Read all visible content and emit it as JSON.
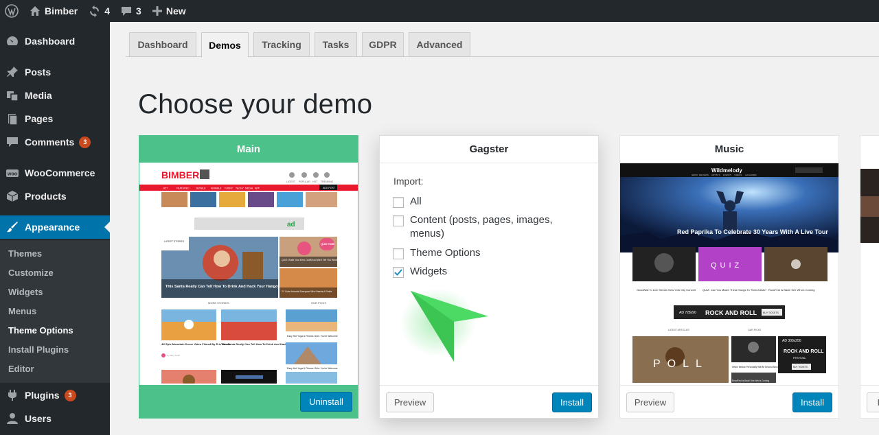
{
  "adminbar": {
    "site_name": "Bimber",
    "updates_count": "4",
    "comments_count": "3",
    "new_label": "New"
  },
  "sidebar": {
    "items": [
      {
        "label": "Dashboard",
        "icon": "dashboard-icon"
      },
      {
        "label": "Posts",
        "icon": "pin-icon"
      },
      {
        "label": "Media",
        "icon": "media-icon"
      },
      {
        "label": "Pages",
        "icon": "pages-icon"
      },
      {
        "label": "Comments",
        "icon": "comment-icon",
        "badge": "3"
      },
      {
        "label": "WooCommerce",
        "icon": "woo-icon"
      },
      {
        "label": "Products",
        "icon": "box-icon"
      },
      {
        "label": "Appearance",
        "icon": "brush-icon",
        "active": true
      },
      {
        "label": "Plugins",
        "icon": "plug-icon",
        "badge": "3"
      },
      {
        "label": "Users",
        "icon": "user-icon"
      }
    ],
    "submenu": [
      "Themes",
      "Customize",
      "Widgets",
      "Menus",
      "Theme Options",
      "Install Plugins",
      "Editor"
    ],
    "submenu_current": "Theme Options"
  },
  "tabs": [
    "Dashboard",
    "Demos",
    "Tracking",
    "Tasks",
    "GDPR",
    "Advanced"
  ],
  "active_tab": "Demos",
  "page_title": "Choose your demo",
  "cards": {
    "main": {
      "title": "Main",
      "button": "Uninstall"
    },
    "gagster": {
      "title": "Gagster",
      "import_label": "Import:",
      "options": [
        {
          "label": "All",
          "checked": false
        },
        {
          "label": "Content (posts, pages, images, menus)",
          "checked": false
        },
        {
          "label": "Theme Options",
          "checked": false
        },
        {
          "label": "Widgets",
          "checked": true
        }
      ],
      "preview_button": "Preview",
      "install_button": "Install"
    },
    "music": {
      "title": "Music",
      "preview_button": "Preview",
      "install_button": "Install"
    },
    "partial": {
      "preview_button": "P"
    }
  },
  "thumbnails": {
    "main": {
      "logo": "BIMBER",
      "nav": [
        "HOT",
        "FEATURED",
        "DETAILS",
        "ANIMALS",
        "FUNNY",
        "TECHY",
        "MEDIA",
        "APP"
      ],
      "header_links": [
        "LATEST",
        "POPULAR",
        "HOT",
        "TRENDING"
      ],
      "add_post": "ADD POST",
      "ad_label": "ad",
      "latest_stories": "LATEST STORIES",
      "hero_title": "This Santa Really Can Tell How To Drink And Hack Your Hangover",
      "side_title_1": "QUIZ: Build Your Emo Outfit And We'll Tell You What You Are",
      "side_title_2": "21 Cute Animals Everyone Who Needs A Smile",
      "quiz_badge": "QUIZ TIME",
      "more_stories": "MORE STORIES",
      "our_picks": "OUR PICKS",
      "story_1": "4K Epic Mountain Drone Video Filmed By Eric Novak",
      "story_1_meta": "by Mary Smith",
      "story_2": "This Santa Really Can Tell How To Drink And Hack Your Hangover",
      "pick_1": "Easy Hot Yoga & Fitness Girls: You're Welcome",
      "pick_2": "Easy Hot Yoga & Fitness Girls: You're Welcome"
    },
    "music": {
      "logo": "Wildmelody",
      "nav": [
        "NEWS",
        "REVIEWS",
        "ARTISTS",
        "EVENTS",
        "VIDEOS",
        "GALLERIES"
      ],
      "hero_title": "Red Paprika To Celebrate 30 Years With A Live Tour",
      "quiz_text": "QUIZ",
      "cap_1": "GoodWall To Live Stream New York City Concert",
      "cap_2": "QUIZ: Can You Match These Songs To Their Artists?",
      "cap_3": "RockFest Is Back! See Who's Coming",
      "ad_size": "AD 728x90",
      "ad_text": "ROCK AND ROLL",
      "ad_btn": "BUY TICKETS",
      "latest_articles": "LATEST ARTICLES",
      "our_picks": "OUR PICKS",
      "poll_text": "POLL",
      "ad2_size": "AD 300x250",
      "ad2_text": "ROCK AND ROLL",
      "ad2_sub": "FESTIVAL",
      "ad2_btn": "BUY TICKETS",
      "pick_1": "Which Mellow Personality Will Be Second Album Is Coming",
      "pick_2": "ReadFest Is Back! See Who's Coming"
    }
  },
  "colors": {
    "adminbar": "#23282d",
    "accent": "#0073aa",
    "main_card": "#4cc18a",
    "primary_button": "#0085ba",
    "badge": "#ca4a1f",
    "cursor": "#4cd964"
  }
}
